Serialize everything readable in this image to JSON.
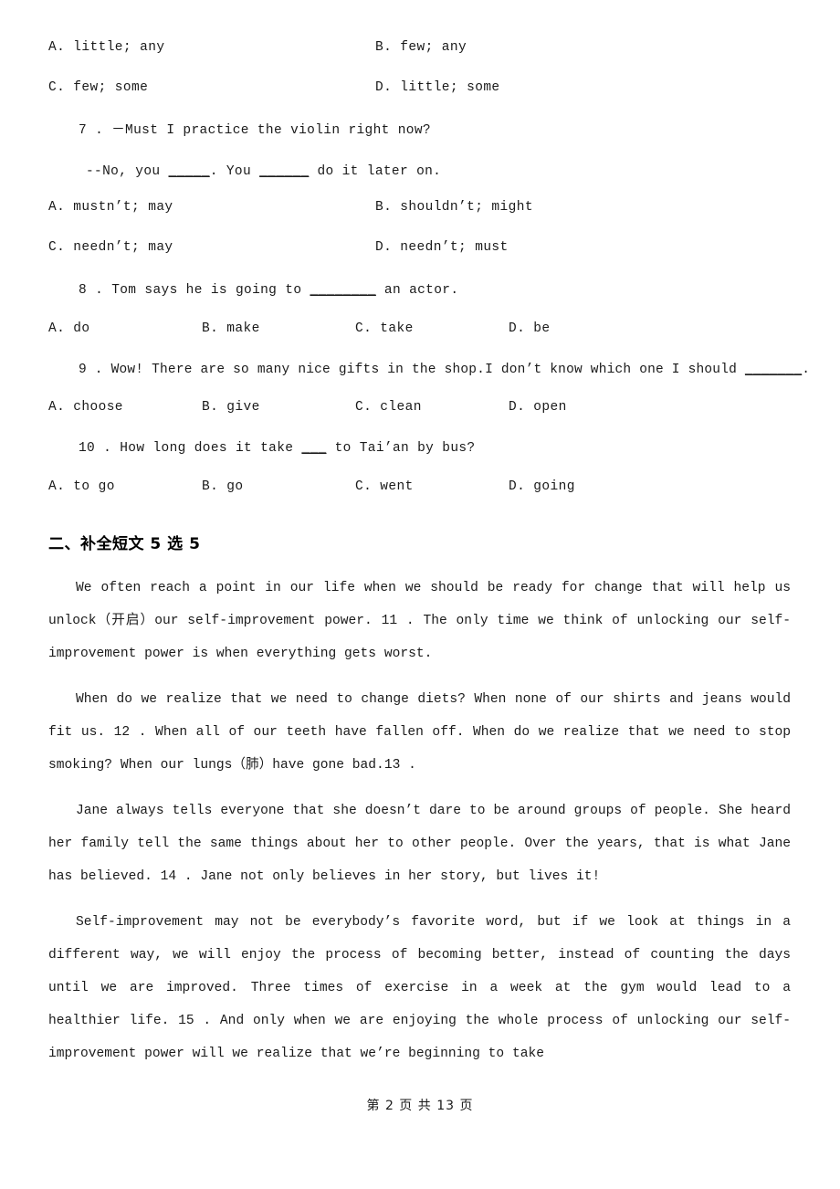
{
  "page": {
    "footer": "第 2 页 共 13 页"
  },
  "questions": [
    {
      "id": "q6-options",
      "options_top": [
        "A. little; any",
        "B. few; any"
      ],
      "options_bottom": [
        "C. few; some",
        "D. little; some"
      ]
    },
    {
      "id": "q7",
      "number": "7 .",
      "stem": "7 .  －Must I practice the violin right now?",
      "sub_pre": "--No, you ",
      "sub_blank1": "_____",
      "sub_mid": ". You ",
      "sub_blank2": "______",
      "sub_post": " do it later on.",
      "options_top": [
        "A. mustn’t; may",
        "B. shouldn’t; might"
      ],
      "options_bottom": [
        "C. needn’t; may",
        "D. needn’t; must"
      ]
    },
    {
      "id": "q8",
      "stem_pre": "8 . Tom says he is going to ",
      "stem_blank": "________",
      "stem_post": " an actor.",
      "options": [
        "A. do",
        "B. make",
        "C. take",
        "D. be"
      ]
    },
    {
      "id": "q9",
      "stem_pre": "9 . Wow! There are so many nice gifts in the shop.I don’t know which one I should ",
      "stem_blank": "_______",
      "stem_post": ".",
      "options": [
        "A. choose",
        "B. give",
        "C. clean",
        "D. open"
      ]
    },
    {
      "id": "q10",
      "stem_pre": "10 . How long does it take ",
      "stem_blank": "___",
      "stem_post": " to Tai’an by bus?",
      "options": [
        "A. to go",
        "B. go",
        "C. went",
        "D. going"
      ]
    }
  ],
  "section": {
    "heading": "二、补全短文 5 选 5",
    "paragraphs": [
      "We often reach a point in our life when we should be ready for change that will help us unlock（开启）our self-improvement power. 11 . The only time we think of unlocking our self-improvement power is when everything gets worst.",
      "When do we realize that we need to change diets? When none of our shirts and jeans would fit us. 12 . When all of our teeth have fallen off. When do we realize that we need to stop smoking? When our lungs（肺）have gone bad.13 .",
      "Jane always tells everyone that she doesn’t dare to be around groups of people. She heard her family tell the same things about her to other people. Over the years, that is what Jane has believed. 14 . Jane not only believes in her story, but lives it!",
      "Self-improvement may not be everybody’s favorite word, but if we look at things in a different way, we will enjoy the process of becoming better, instead of counting the days until we are improved. Three times of exercise in a week at the gym would lead to a healthier life. 15 . And only when we are enjoying the whole process of unlocking our self-improvement power will we realize that we’re beginning to take"
    ]
  }
}
